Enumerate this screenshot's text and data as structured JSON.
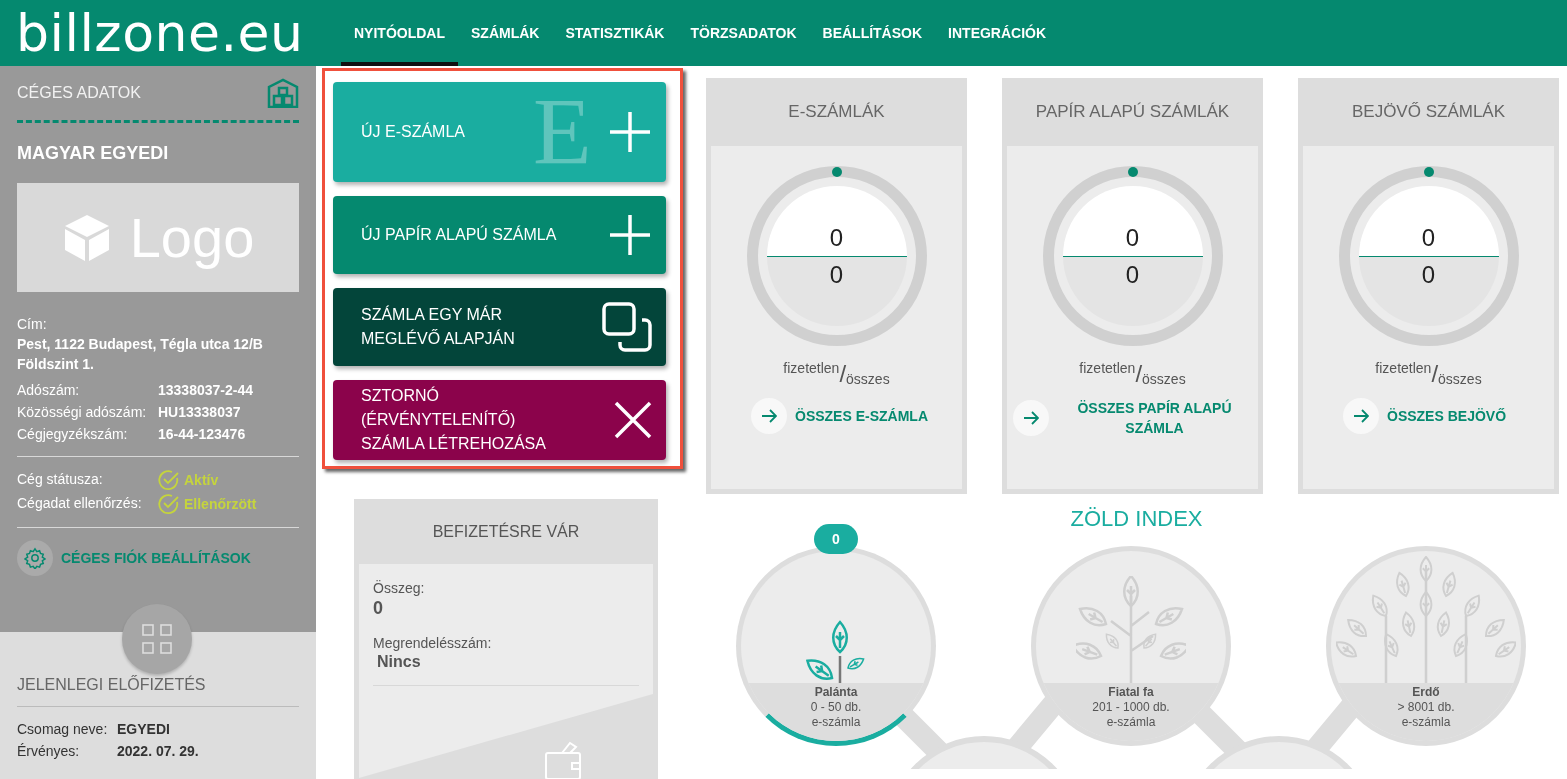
{
  "brand": {
    "name": "billzone.eu"
  },
  "nav": [
    {
      "label": "NYITÓOLDAL",
      "selected": true
    },
    {
      "label": "SZÁMLÁK",
      "selected": false
    },
    {
      "label": "STATISZTIKÁK",
      "selected": false
    },
    {
      "label": "TÖRZSADATOK",
      "selected": false
    },
    {
      "label": "BEÁLLÍTÁSOK",
      "selected": false
    },
    {
      "label": "INTEGRÁCIÓK",
      "selected": false
    }
  ],
  "sidebar": {
    "title": "CÉGES ADATOK",
    "company": "MAGYAR EGYEDI",
    "logo_placeholder": "Logo",
    "address_label": "Cím:",
    "address": "Pest, 1122 Budapest, Tégla utca 12/B Földszint 1.",
    "details": [
      {
        "label": "Adószám:",
        "value": "13338037-2-44"
      },
      {
        "label": "Közösségi adószám:",
        "value": "HU13338037"
      },
      {
        "label": "Cégjegyzékszám:",
        "value": "16-44-123476"
      }
    ],
    "statuses": [
      {
        "label": "Cég státusza:",
        "value": "Aktív",
        "ok": true
      },
      {
        "label": "Cégadat ellenőrzés:",
        "value": "Ellenőrzött",
        "ok": true
      }
    ],
    "settings_link": "CÉGES FIÓK BEÁLLÍTÁSOK",
    "subscription_title": "JELENLEGI ELŐFIZETÉS",
    "subscription": [
      {
        "label": "Csomag neve:",
        "value": "EGYEDI"
      },
      {
        "label": "Érvényes:",
        "value": "2022. 07. 29."
      }
    ]
  },
  "actions": [
    {
      "label": "ÚJ E-SZÁMLA",
      "kind": "add",
      "color": "#1aada0",
      "watermark": "E"
    },
    {
      "label": "ÚJ PAPÍR ALAPÚ SZÁMLA",
      "kind": "add",
      "color": "#05896f"
    },
    {
      "label": "SZÁMLA EGY MÁR MEGLÉVŐ ALAPJÁN",
      "kind": "copy",
      "color": "#03453a"
    },
    {
      "label": "SZTORNÓ (ÉRVÉNYTELENÍTŐ) SZÁMLA LÉTREHOZÁSA",
      "kind": "cancel",
      "color": "#8b034b"
    }
  ],
  "invoice_cards": [
    {
      "title": "E-SZÁMLÁK",
      "unpaid": "0",
      "total": "0",
      "unpaid_label": "fizetetlen",
      "separator": "/",
      "total_label": "összes",
      "link": "ÖSSZES E-SZÁMLA"
    },
    {
      "title": "PAPÍR ALAPÚ SZÁMLÁK",
      "unpaid": "0",
      "total": "0",
      "unpaid_label": "fizetetlen",
      "separator": "/",
      "total_label": "összes",
      "link": "ÖSSZES PAPÍR ALAPÚ SZÁMLA"
    },
    {
      "title": "BEJÖVŐ SZÁMLÁK",
      "unpaid": "0",
      "total": "0",
      "unpaid_label": "fizetetlen",
      "separator": "/",
      "total_label": "összes",
      "link": "ÖSSZES BEJÖVŐ"
    }
  ],
  "payment": {
    "title": "BEFIZETÉSRE VÁR",
    "amount_label": "Összeg:",
    "amount": "0",
    "order_label": "Megrendelésszám:",
    "order": "Nincs"
  },
  "green_index": {
    "title": "ZÖLD INDEX",
    "stages": [
      {
        "name": "Palánta",
        "range": "0 - 50 db.",
        "unit": "e-számla",
        "kind": "sapling",
        "active": true,
        "badge": "0"
      },
      {
        "name": "Fiatal fa",
        "range": "201 - 1000 db.",
        "unit": "e-számla",
        "kind": "tree",
        "active": false
      },
      {
        "name": "Erdő",
        "range": "> 8001 db.",
        "unit": "e-számla",
        "kind": "forest",
        "active": false
      }
    ]
  }
}
